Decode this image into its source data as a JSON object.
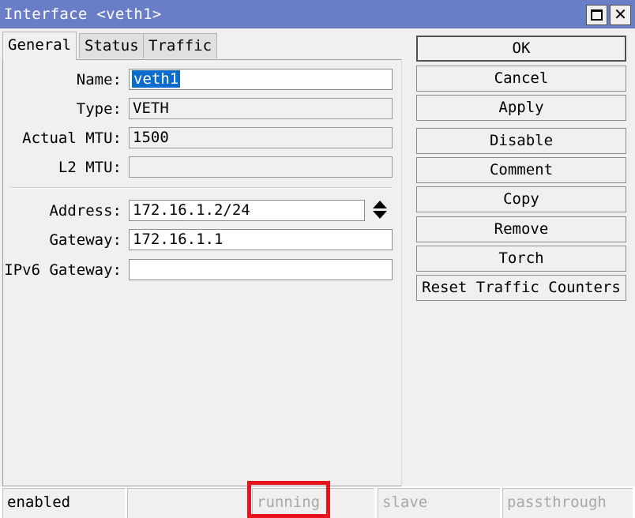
{
  "window": {
    "title": "Interface <veth1>",
    "controls": {
      "maximize": "maximize-icon",
      "close": "✕"
    }
  },
  "tabs": [
    {
      "label": "General",
      "active": true
    },
    {
      "label": "Status",
      "active": false
    },
    {
      "label": "Traffic",
      "active": false
    }
  ],
  "general": {
    "name": {
      "label": "Name:",
      "value": "veth1"
    },
    "type": {
      "label": "Type:",
      "value": "VETH"
    },
    "actual_mtu": {
      "label": "Actual MTU:",
      "value": "1500"
    },
    "l2_mtu": {
      "label": "L2 MTU:",
      "value": ""
    },
    "address": {
      "label": "Address:",
      "value": "172.16.1.2/24"
    },
    "gateway": {
      "label": "Gateway:",
      "value": "172.16.1.1"
    },
    "ipv6_gateway": {
      "label": "IPv6 Gateway:",
      "value": ""
    }
  },
  "buttons": {
    "ok": "OK",
    "cancel": "Cancel",
    "apply": "Apply",
    "disable": "Disable",
    "comment": "Comment",
    "copy": "Copy",
    "remove": "Remove",
    "torch": "Torch",
    "reset_traffic_counters": "Reset Traffic Counters"
  },
  "status_bar": {
    "enabled": "enabled",
    "blank": "",
    "running": "running",
    "slave": "slave",
    "passthrough": "passthrough"
  },
  "colors": {
    "titlebar": "#6a7ec8",
    "selection": "#0a6ccc",
    "highlight": "#e8141c"
  }
}
